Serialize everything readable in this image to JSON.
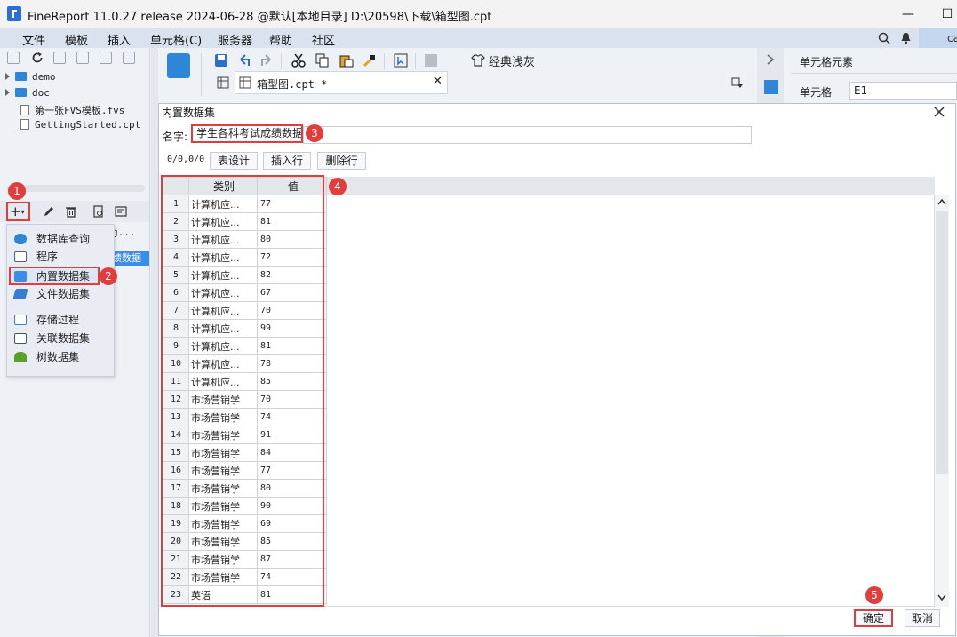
{
  "app": {
    "title": "FineReport 11.0.27 release 2024-06-28 @默认[本地目录]    D:\\20598\\下载\\箱型图.cpt",
    "minimize": "—",
    "maximize": "☐"
  },
  "menu": {
    "items": [
      "文件",
      "模板",
      "插入",
      "单元格(C)",
      "服务器",
      "帮助",
      "社区"
    ],
    "right_text": "ca"
  },
  "tree": {
    "items": [
      {
        "label": "demo",
        "type": "folder"
      },
      {
        "label": "doc",
        "type": "folder"
      },
      {
        "label": "第一张FVS模板.fvs",
        "type": "file"
      },
      {
        "label": "GettingStarted.cpt",
        "type": "file"
      }
    ]
  },
  "dataset_panel": {
    "partial_item": "g...",
    "selected_partial": "绩数据"
  },
  "dropdown": {
    "items": [
      {
        "label": "数据库查询",
        "icon": "database-icon",
        "color": "#2f86d8"
      },
      {
        "label": "程序",
        "icon": "monitor-icon",
        "color": "#5a6270"
      },
      {
        "label": "内置数据集",
        "icon": "builtin-dataset-icon",
        "color": "#3a8ee6"
      },
      {
        "label": "文件数据集",
        "icon": "file-dataset-icon",
        "color": "#3a7bd5"
      },
      {
        "label": "存储过程",
        "icon": "stored-procedure-icon",
        "color": "#3a7bd5"
      },
      {
        "label": "关联数据集",
        "icon": "relation-dataset-icon",
        "color": "#4c5560"
      },
      {
        "label": "树数据集",
        "icon": "tree-dataset-icon",
        "color": "#5aa02c"
      }
    ]
  },
  "template_tab": {
    "label": "箱型图.cpt *",
    "theme_label": "经典浅灰"
  },
  "right_panel": {
    "title": "单元格元素",
    "cell_label": "单元格",
    "cell_value": "E1"
  },
  "dialog": {
    "title": "内置数据集",
    "name_label": "名字:",
    "name_value": "学生各科考试成绩数据",
    "position": "0/0,0/0",
    "buttons": {
      "design": "表设计",
      "insert_row": "插入行",
      "delete_row": "删除行"
    },
    "ok": "确定",
    "cancel": "取消"
  },
  "table": {
    "headers": [
      "类别",
      "值"
    ],
    "rows": [
      [
        "1",
        "计算机应...",
        "77"
      ],
      [
        "2",
        "计算机应...",
        "81"
      ],
      [
        "3",
        "计算机应...",
        "80"
      ],
      [
        "4",
        "计算机应...",
        "72"
      ],
      [
        "5",
        "计算机应...",
        "82"
      ],
      [
        "6",
        "计算机应...",
        "67"
      ],
      [
        "7",
        "计算机应...",
        "70"
      ],
      [
        "8",
        "计算机应...",
        "99"
      ],
      [
        "9",
        "计算机应...",
        "81"
      ],
      [
        "10",
        "计算机应...",
        "78"
      ],
      [
        "11",
        "计算机应...",
        "85"
      ],
      [
        "12",
        "市场营销学",
        "70"
      ],
      [
        "13",
        "市场营销学",
        "74"
      ],
      [
        "14",
        "市场营销学",
        "91"
      ],
      [
        "15",
        "市场营销学",
        "84"
      ],
      [
        "16",
        "市场营销学",
        "77"
      ],
      [
        "17",
        "市场营销学",
        "80"
      ],
      [
        "18",
        "市场营销学",
        "90"
      ],
      [
        "19",
        "市场营销学",
        "69"
      ],
      [
        "20",
        "市场营销学",
        "85"
      ],
      [
        "21",
        "市场营销学",
        "87"
      ],
      [
        "22",
        "市场营销学",
        "74"
      ],
      [
        "23",
        "英语",
        "81"
      ]
    ]
  },
  "annotations": {
    "step1": "1",
    "step2": "2",
    "step3": "3",
    "step4": "4",
    "step5": "5",
    "color": "#e23d3d"
  }
}
